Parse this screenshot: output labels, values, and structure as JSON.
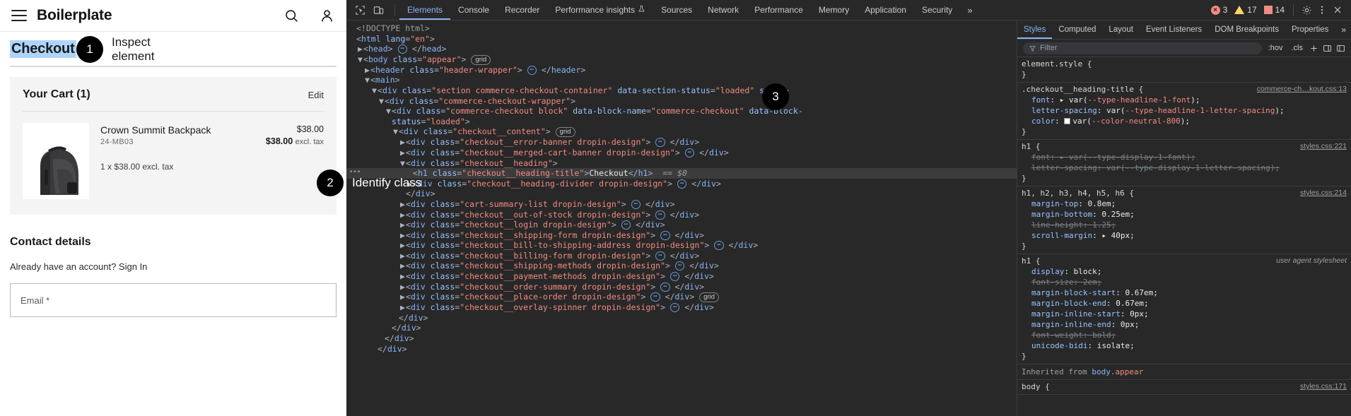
{
  "page": {
    "brand": "Boilerplate",
    "icons": {
      "menu": "hamburger-icon",
      "search": "search-icon",
      "account": "user-icon"
    },
    "checkout_title": "Checkout",
    "cart": {
      "title": "Your Cart (1)",
      "edit_label": "Edit",
      "item": {
        "name": "Crown Summit Backpack",
        "sku": "24-MB03",
        "qty_line": "1 x $38.00 excl. tax",
        "price": "$38.00",
        "price_total": "$38.00",
        "price_total_tax": "excl. tax"
      }
    },
    "contact": {
      "title": "Contact details",
      "signin_prompt": "Already have an account? Sign In",
      "email_placeholder": "Email *"
    }
  },
  "callouts": [
    {
      "num": "1",
      "label": "Inspect element"
    },
    {
      "num": "2",
      "label": "Identify class"
    },
    {
      "num": "3",
      "label": ""
    }
  ],
  "devtools": {
    "toolbar_icons": [
      "inspect-element-icon",
      "device-toolbar-icon"
    ],
    "tabs": [
      {
        "label": "Elements",
        "active": true
      },
      {
        "label": "Console",
        "active": false
      },
      {
        "label": "Recorder",
        "active": false
      },
      {
        "label": "Performance insights",
        "active": false
      },
      {
        "label": "Sources",
        "active": false
      },
      {
        "label": "Network",
        "active": false
      },
      {
        "label": "Performance",
        "active": false
      },
      {
        "label": "Memory",
        "active": false
      },
      {
        "label": "Application",
        "active": false
      },
      {
        "label": "Security",
        "active": false
      }
    ],
    "more_tabs": "»",
    "counters": {
      "errors": "3",
      "warnings": "17",
      "issues": "14"
    },
    "settings_icon": "gear-icon",
    "menu_icon": "kebab-menu-icon",
    "close_icon": "close-icon",
    "dom_lines": [
      {
        "indent": 0,
        "twisty": "",
        "html": "<span class=\"doctype\">&lt;!DOCTYPE html&gt;</span>"
      },
      {
        "indent": 0,
        "twisty": "",
        "html": "<span class=\"punct\">&lt;</span><span class=\"tagname\">html</span> <span class=\"attrname\">lang</span><span class=\"punct\">=</span><span class=\"attrval\">\"en\"</span><span class=\"punct\">&gt;</span>"
      },
      {
        "indent": 1,
        "twisty": "closed",
        "html": "<span class=\"punct\">&lt;</span><span class=\"tagname\">head</span><span class=\"punct\">&gt;</span> <span class=\"ellipsis-b\">⋯</span> <span class=\"punct\">&lt;/</span><span class=\"tagname\">head</span><span class=\"punct\">&gt;</span>"
      },
      {
        "indent": 1,
        "twisty": "open",
        "html": "<span class=\"punct\">&lt;</span><span class=\"tagname\">body</span> <span class=\"attrname\">class</span><span class=\"punct\">=</span><span class=\"attrval\">\"appear\"</span><span class=\"punct\">&gt;</span> <span class=\"badge-grid\">grid</span>"
      },
      {
        "indent": 2,
        "twisty": "closed",
        "html": "<span class=\"punct\">&lt;</span><span class=\"tagname\">header</span> <span class=\"attrname\">class</span><span class=\"punct\">=</span><span class=\"attrval\">\"header-wrapper\"</span><span class=\"punct\">&gt;</span> <span class=\"ellipsis-b\">⋯</span> <span class=\"punct\">&lt;/</span><span class=\"tagname\">header</span><span class=\"punct\">&gt;</span>"
      },
      {
        "indent": 2,
        "twisty": "open",
        "html": "<span class=\"punct\">&lt;</span><span class=\"tagname\">main</span><span class=\"punct\">&gt;</span>"
      },
      {
        "indent": 3,
        "twisty": "open",
        "html": "<span class=\"punct\">&lt;</span><span class=\"tagname\">div</span> <span class=\"attrname\">class</span><span class=\"punct\">=</span><span class=\"attrval\">\"section commerce-checkout-container\"</span> <span class=\"attrname\">data-section-status</span><span class=\"punct\">=</span><span class=\"attrval\">\"loaded\"</span> <span class=\"attrname\">style</span><span class=\"punct\">&gt;</span>"
      },
      {
        "indent": 4,
        "twisty": "open",
        "html": "<span class=\"punct\">&lt;</span><span class=\"tagname\">div</span> <span class=\"attrname\">class</span><span class=\"punct\">=</span><span class=\"attrval\">\"commerce-checkout-wrapper\"</span><span class=\"punct\">&gt;</span>"
      },
      {
        "indent": 5,
        "twisty": "open",
        "html": "<span class=\"punct\">&lt;</span><span class=\"tagname\">div</span> <span class=\"attrname\">class</span><span class=\"punct\">=</span><span class=\"attrval\">\"commerce-checkout block\"</span> <span class=\"attrname\">data-block-name</span><span class=\"punct\">=</span><span class=\"attrval\">\"commerce-checkout\"</span> <span class=\"attrname\">data-block-</span>"
      },
      {
        "indent": 5,
        "twisty": "none",
        "html": "<span class=\"attrname\">status</span><span class=\"punct\">=</span><span class=\"attrval\">\"loaded\"</span><span class=\"punct\">&gt;</span>"
      },
      {
        "indent": 6,
        "twisty": "open",
        "html": "<span class=\"punct\">&lt;</span><span class=\"tagname\">div</span> <span class=\"attrname\">class</span><span class=\"punct\">=</span><span class=\"attrval\">\"checkout__content\"</span><span class=\"punct\">&gt;</span> <span class=\"badge-grid\">grid</span>"
      },
      {
        "indent": 7,
        "twisty": "closed",
        "html": "<span class=\"punct\">&lt;</span><span class=\"tagname\">div</span> <span class=\"attrname\">class</span><span class=\"punct\">=</span><span class=\"attrval\">\"checkout__error-banner dropin-design\"</span><span class=\"punct\">&gt;</span> <span class=\"ellipsis-b\">⋯</span> <span class=\"punct\">&lt;/</span><span class=\"tagname\">div</span><span class=\"punct\">&gt;</span>"
      },
      {
        "indent": 7,
        "twisty": "closed",
        "html": "<span class=\"punct\">&lt;</span><span class=\"tagname\">div</span> <span class=\"attrname\">class</span><span class=\"punct\">=</span><span class=\"attrval\">\"checkout__merged-cart-banner dropin-design\"</span><span class=\"punct\">&gt;</span> <span class=\"ellipsis-b\">⋯</span> <span class=\"punct\">&lt;/</span><span class=\"tagname\">div</span><span class=\"punct\">&gt;</span>"
      },
      {
        "indent": 7,
        "twisty": "open",
        "html": "<span class=\"punct\">&lt;</span><span class=\"tagname\">div</span> <span class=\"attrname\">class</span><span class=\"punct\">=</span><span class=\"attrval\">\"checkout__heading\"</span><span class=\"punct\">&gt;</span>"
      },
      {
        "indent": 8,
        "twisty": "none",
        "selected": true,
        "html": "<span class=\"punct\">&lt;</span><span class=\"tagname\">h1</span> <span class=\"attrname\">class</span><span class=\"punct\">=</span><span class=\"attrval\">\"checkout__heading-title\"</span><span class=\"punct\">&gt;</span><span class=\"txtnode\">Checkout</span><span class=\"punct\">&lt;/</span><span class=\"tagname\">h1</span><span class=\"punct\">&gt;</span>  <span class=\"eq0\">== $0</span>"
      },
      {
        "indent": 8,
        "twisty": "closed",
        "html": "<span class=\"punct\">&lt;</span><span class=\"tagname\">div</span> <span class=\"attrname\">class</span><span class=\"punct\">=</span><span class=\"attrval\">\"checkout__heading-divider dropin-design\"</span><span class=\"punct\">&gt;</span> <span class=\"ellipsis-b\">⋯</span> <span class=\"punct\">&lt;/</span><span class=\"tagname\">div</span><span class=\"punct\">&gt;</span>"
      },
      {
        "indent": 7,
        "twisty": "none",
        "html": "<span class=\"punct\">&lt;/</span><span class=\"tagname\">div</span><span class=\"punct\">&gt;</span>"
      },
      {
        "indent": 7,
        "twisty": "closed",
        "html": "<span class=\"punct\">&lt;</span><span class=\"tagname\">div</span> <span class=\"attrname\">class</span><span class=\"punct\">=</span><span class=\"attrval\">\"cart-summary-list dropin-design\"</span><span class=\"punct\">&gt;</span> <span class=\"ellipsis-b\">⋯</span> <span class=\"punct\">&lt;/</span><span class=\"tagname\">div</span><span class=\"punct\">&gt;</span>"
      },
      {
        "indent": 7,
        "twisty": "closed",
        "html": "<span class=\"punct\">&lt;</span><span class=\"tagname\">div</span> <span class=\"attrname\">class</span><span class=\"punct\">=</span><span class=\"attrval\">\"checkout__out-of-stock dropin-design\"</span><span class=\"punct\">&gt;</span> <span class=\"ellipsis-b\">⋯</span> <span class=\"punct\">&lt;/</span><span class=\"tagname\">div</span><span class=\"punct\">&gt;</span>"
      },
      {
        "indent": 7,
        "twisty": "closed",
        "html": "<span class=\"punct\">&lt;</span><span class=\"tagname\">div</span> <span class=\"attrname\">class</span><span class=\"punct\">=</span><span class=\"attrval\">\"checkout__login dropin-design\"</span><span class=\"punct\">&gt;</span> <span class=\"ellipsis-b\">⋯</span> <span class=\"punct\">&lt;/</span><span class=\"tagname\">div</span><span class=\"punct\">&gt;</span>"
      },
      {
        "indent": 7,
        "twisty": "closed",
        "html": "<span class=\"punct\">&lt;</span><span class=\"tagname\">div</span> <span class=\"attrname\">class</span><span class=\"punct\">=</span><span class=\"attrval\">\"checkout__shipping-form dropin-design\"</span><span class=\"punct\">&gt;</span> <span class=\"ellipsis-b\">⋯</span> <span class=\"punct\">&lt;/</span><span class=\"tagname\">div</span><span class=\"punct\">&gt;</span>"
      },
      {
        "indent": 7,
        "twisty": "closed",
        "html": "<span class=\"punct\">&lt;</span><span class=\"tagname\">div</span> <span class=\"attrname\">class</span><span class=\"punct\">=</span><span class=\"attrval\">\"checkout__bill-to-shipping-address dropin-design\"</span><span class=\"punct\">&gt;</span> <span class=\"ellipsis-b\">⋯</span> <span class=\"punct\">&lt;/</span><span class=\"tagname\">div</span><span class=\"punct\">&gt;</span>"
      },
      {
        "indent": 7,
        "twisty": "closed",
        "html": "<span class=\"punct\">&lt;</span><span class=\"tagname\">div</span> <span class=\"attrname\">class</span><span class=\"punct\">=</span><span class=\"attrval\">\"checkout__billing-form dropin-design\"</span><span class=\"punct\">&gt;</span> <span class=\"ellipsis-b\">⋯</span> <span class=\"punct\">&lt;/</span><span class=\"tagname\">div</span><span class=\"punct\">&gt;</span>"
      },
      {
        "indent": 7,
        "twisty": "closed",
        "html": "<span class=\"punct\">&lt;</span><span class=\"tagname\">div</span> <span class=\"attrname\">class</span><span class=\"punct\">=</span><span class=\"attrval\">\"checkout__shipping-methods dropin-design\"</span><span class=\"punct\">&gt;</span> <span class=\"ellipsis-b\">⋯</span> <span class=\"punct\">&lt;/</span><span class=\"tagname\">div</span><span class=\"punct\">&gt;</span>"
      },
      {
        "indent": 7,
        "twisty": "closed",
        "html": "<span class=\"punct\">&lt;</span><span class=\"tagname\">div</span> <span class=\"attrname\">class</span><span class=\"punct\">=</span><span class=\"attrval\">\"checkout__payment-methods dropin-design\"</span><span class=\"punct\">&gt;</span> <span class=\"ellipsis-b\">⋯</span> <span class=\"punct\">&lt;/</span><span class=\"tagname\">div</span><span class=\"punct\">&gt;</span>"
      },
      {
        "indent": 7,
        "twisty": "closed",
        "html": "<span class=\"punct\">&lt;</span><span class=\"tagname\">div</span> <span class=\"attrname\">class</span><span class=\"punct\">=</span><span class=\"attrval\">\"checkout__order-summary dropin-design\"</span><span class=\"punct\">&gt;</span> <span class=\"ellipsis-b\">⋯</span> <span class=\"punct\">&lt;/</span><span class=\"tagname\">div</span><span class=\"punct\">&gt;</span>"
      },
      {
        "indent": 7,
        "twisty": "closed",
        "html": "<span class=\"punct\">&lt;</span><span class=\"tagname\">div</span> <span class=\"attrname\">class</span><span class=\"punct\">=</span><span class=\"attrval\">\"checkout__place-order dropin-design\"</span><span class=\"punct\">&gt;</span> <span class=\"ellipsis-b\">⋯</span> <span class=\"punct\">&lt;/</span><span class=\"tagname\">div</span><span class=\"punct\">&gt;</span> <span class=\"badge-grid\">grid</span>"
      },
      {
        "indent": 7,
        "twisty": "closed",
        "html": "<span class=\"punct\">&lt;</span><span class=\"tagname\">div</span> <span class=\"attrname\">class</span><span class=\"punct\">=</span><span class=\"attrval\">\"checkout__overlay-spinner dropin-design\"</span><span class=\"punct\">&gt;</span> <span class=\"ellipsis-b\">⋯</span> <span class=\"punct\">&lt;/</span><span class=\"tagname\">div</span><span class=\"punct\">&gt;</span>"
      },
      {
        "indent": 6,
        "twisty": "none",
        "html": "<span class=\"punct\">&lt;/</span><span class=\"tagname\">div</span><span class=\"punct\">&gt;</span>"
      },
      {
        "indent": 5,
        "twisty": "none",
        "html": "<span class=\"punct\">&lt;/</span><span class=\"tagname\">div</span><span class=\"punct\">&gt;</span>"
      },
      {
        "indent": 4,
        "twisty": "none",
        "html": "<span class=\"punct\">&lt;/</span><span class=\"tagname\">div</span><span class=\"punct\">&gt;</span>"
      },
      {
        "indent": 3,
        "twisty": "none",
        "html": "<span class=\"punct\">&lt;/</span><span class=\"tagname\">div</span><span class=\"punct\">&gt;</span>"
      }
    ],
    "styles": {
      "tabs": [
        {
          "label": "Styles",
          "active": true
        },
        {
          "label": "Computed",
          "active": false
        },
        {
          "label": "Layout",
          "active": false
        },
        {
          "label": "Event Listeners",
          "active": false
        },
        {
          "label": "DOM Breakpoints",
          "active": false
        },
        {
          "label": "Properties",
          "active": false
        }
      ],
      "more_chevron": "»",
      "filter_placeholder": "Filter",
      "filter_icon": "filter-icon",
      "hov_label": ":hov",
      "cls_label": ".cls",
      "new_rule_icon": "plus-icon",
      "computed_sidebar_icon": "computed-panel-icon",
      "toggle_icon": "toggle-panel-icon",
      "rules": [
        {
          "selector": "element.style {",
          "source": "",
          "decls": [],
          "close": "}"
        },
        {
          "selector": ".checkout__heading-title {",
          "source": "commerce-ch…kout.css:13",
          "decls": [
            {
              "prop": "font",
              "value": "▸ var(--type-headline-1-font);",
              "struck": false,
              "expandable": true,
              "varpart": "--type-headline-1-font"
            },
            {
              "prop": "letter-spacing",
              "value": "var(--type-headline-1-letter-spacing);",
              "struck": false,
              "varpart": "--type-headline-1-letter-spacing"
            },
            {
              "prop": "color",
              "value": "var(--color-neutral-800);",
              "struck": false,
              "swatch": true,
              "varpart": "--color-neutral-800"
            }
          ],
          "close": "}"
        },
        {
          "selector": "h1 {",
          "source": "styles.css:221",
          "decls": [
            {
              "prop": "font",
              "value": "▸ var(--type-display-1-font);",
              "struck": true,
              "varpart": "--type-display-1-font"
            },
            {
              "prop": "letter-spacing",
              "value": "var(--type-display-1-letter-spacing);",
              "struck": true,
              "varpart": "--type-display-1-letter-spacing"
            }
          ],
          "close": "}"
        },
        {
          "selector": "h1, h2, h3, h4, h5, h6 {",
          "source": "styles.css:214",
          "decls": [
            {
              "prop": "margin-top",
              "value": "0.8em;",
              "struck": false
            },
            {
              "prop": "margin-bottom",
              "value": "0.25em;",
              "struck": false
            },
            {
              "prop": "line-height",
              "value": "1.25;",
              "struck": true
            },
            {
              "prop": "scroll-margin",
              "value": "▸ 40px;",
              "struck": false
            }
          ],
          "close": "}"
        },
        {
          "selector": "h1 {",
          "source": "user agent stylesheet",
          "source_italic": true,
          "decls": [
            {
              "prop": "display",
              "value": "block;",
              "struck": false
            },
            {
              "prop": "font-size",
              "value": "2em;",
              "struck": true
            },
            {
              "prop": "margin-block-start",
              "value": "0.67em;",
              "struck": false
            },
            {
              "prop": "margin-block-end",
              "value": "0.67em;",
              "struck": false
            },
            {
              "prop": "margin-inline-start",
              "value": "0px;",
              "struck": false
            },
            {
              "prop": "margin-inline-end",
              "value": "0px;",
              "struck": false
            },
            {
              "prop": "font-weight",
              "value": "bold;",
              "struck": true
            },
            {
              "prop": "unicode-bidi",
              "value": "isolate;",
              "struck": false
            }
          ],
          "close": "}"
        }
      ],
      "inherited_label": "Inherited from",
      "inherited_tag": "body",
      "inherited_class": ".appear",
      "last_rule": {
        "selector": "body {",
        "source": "styles.css:171"
      }
    }
  }
}
